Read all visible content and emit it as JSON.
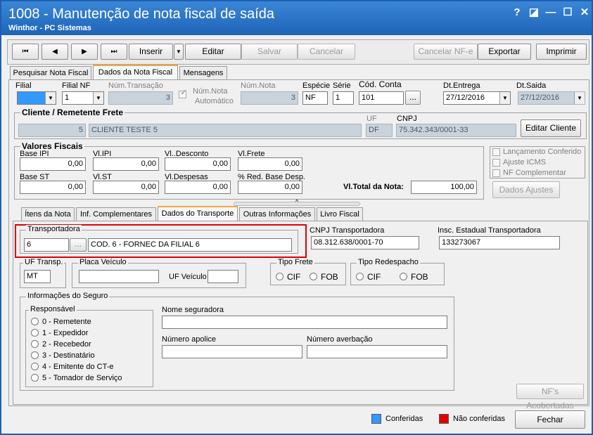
{
  "window": {
    "title": "1008 - Manutenção de nota fiscal de saída",
    "subtitle": "Winthor - PC Sistemas",
    "help": "?",
    "restore": "◪",
    "minimize": "—",
    "maximize": "☐",
    "close": "✕"
  },
  "toolbar": {
    "first": "⏮",
    "prev": "◀",
    "next": "▶",
    "last": "⏭",
    "inserir": "Inserir",
    "inserir_dd": "▼",
    "editar": "Editar",
    "salvar": "Salvar",
    "cancelar": "Cancelar",
    "cancelar_nfe": "Cancelar NF-e",
    "exportar": "Exportar",
    "imprimir": "Imprimir"
  },
  "main_tabs": [
    "Pesquisar Nota Fiscal",
    "Dados da Nota Fiscal",
    "Mensagens"
  ],
  "header": {
    "filial_label": "Filial",
    "filial_value": "",
    "filial_nf_label": "Filial NF",
    "filial_nf_value": "1",
    "num_transacao_label": "Núm.Transação",
    "num_transacao_value": "3",
    "num_nota_auto_label1": "Núm.Nota",
    "num_nota_auto_label2": "Automático",
    "num_nota_label": "Núm.Nota",
    "num_nota_value": "3",
    "especie_label": "Espécie",
    "especie_value": "NF",
    "serie_label": "Série",
    "serie_value": "1",
    "cod_conta_label": "Cód. Conta",
    "cod_conta_value": "101",
    "ellipsis": "...",
    "dt_entrega_label": "Dt.Entrega",
    "dt_entrega_value": "27/12/2016",
    "dt_saida_label": "Dt.Saida",
    "dt_saida_value": "27/12/2016"
  },
  "cliente": {
    "title": "Cliente / Remetente Frete",
    "codigo": "5",
    "nome": "CLIENTE TESTE 5",
    "uf_label": "UF",
    "uf_value": "DF",
    "cnpj_label": "CNPJ",
    "cnpj_value": "75.342.343/0001-33",
    "editar_cliente": "Editar Cliente"
  },
  "valores": {
    "title": "Valores Fiscais",
    "base_ipi_label": "Base IPI",
    "base_ipi": "0,00",
    "vl_ipi_label": "Vl.IPI",
    "vl_ipi": "0,00",
    "vl_desconto_label": "Vl..Desconto",
    "vl_desconto": "0,00",
    "vl_frete_label": "Vl.Frete",
    "vl_frete": "0,00",
    "base_st_label": "Base ST",
    "base_st": "0,00",
    "vl_st_label": "Vl.ST",
    "vl_st": "0,00",
    "vl_despesas_label": "Vl.Despesas",
    "vl_despesas": "0,00",
    "red_base_label": "% Red. Base Desp.",
    "red_base": "0,00",
    "vl_total_label": "Vl.Total da Nota:",
    "vl_total": "100,00"
  },
  "flags": {
    "lancamento": "Lançamento Conferido",
    "ajuste": "Ajuste ICMS",
    "nf_complementar": "NF Complementar",
    "dados_ajustes": "Dados Ajustes"
  },
  "sub_tabs": [
    "Ítens da Nota",
    "Inf. Complementares",
    "Dados do Transporte",
    "Outras Informações",
    "Livro Fiscal"
  ],
  "transporte": {
    "transportadora_label": "Transportadora",
    "transportadora_cod": "6",
    "transportadora_nome": "COD. 6 - FORNEC DA FILIAL 6",
    "cnpj_label": "CNPJ Transportadora",
    "cnpj_value": "08.312.638/0001-70",
    "insc_label": "Insc. Estadual Transportadora",
    "insc_value": "133273067",
    "uf_transp_label": "UF Transp.",
    "uf_transp_value": "MT",
    "placa_label": "Placa Veículo",
    "placa_value": "",
    "uf_veiculo_label": "UF Veículo",
    "uf_veiculo_value": "",
    "tipo_frete_label": "Tipo Frete",
    "tipo_redespacho_label": "Tipo Redespacho",
    "cif": "CIF",
    "fob": "FOB"
  },
  "seguro": {
    "title": "Informações do Seguro",
    "responsavel_label": "Responsável",
    "opcoes": [
      "0 - Remetente",
      "1 - Expedidor",
      "2 - Recebedor",
      "3 - Destinatário",
      "4 - Emitente do CT-e",
      "5 - Tomador de Serviço"
    ],
    "nome_seguradora_label": "Nome seguradora",
    "numero_apolice_label": "Número apolice",
    "numero_averbacao_label": "Número averbação",
    "nfs_acobertadas": "NF's Acobertadas"
  },
  "footer": {
    "conferidas": "Conferidas",
    "nao_conferidas": "Não conferidas",
    "fechar": "Fechar"
  },
  "colors": {
    "title_bar": "#1e64b8",
    "conferidas": "#3399ff",
    "nao_conferidas": "#e00000",
    "highlight": "#e00000",
    "active_tab_accent": "#f2a73b"
  }
}
